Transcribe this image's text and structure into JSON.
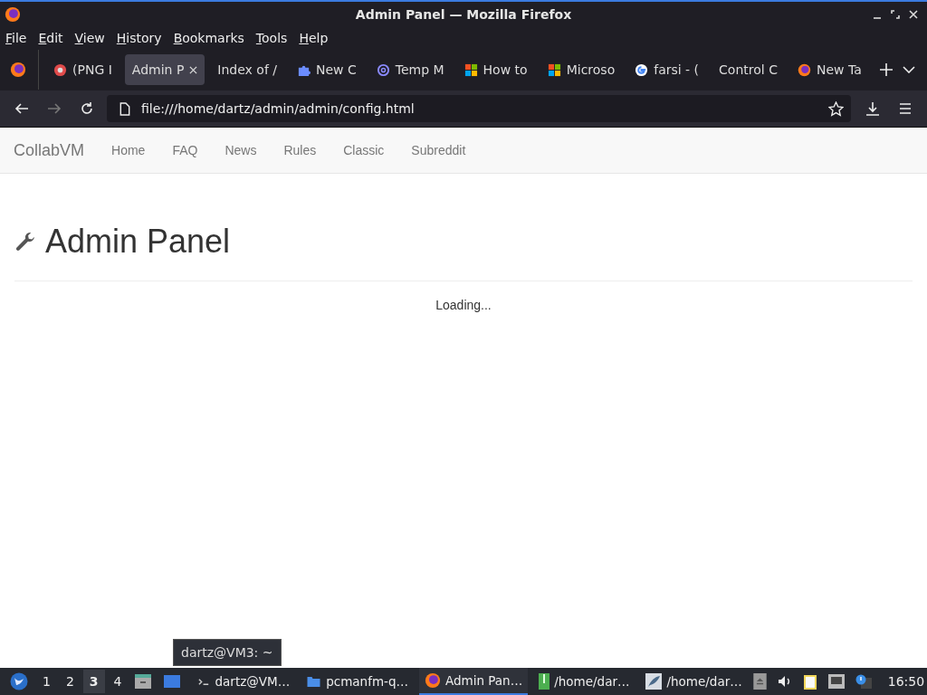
{
  "window": {
    "title": "Admin Panel — Mozilla Firefox"
  },
  "menu": [
    {
      "label": "File"
    },
    {
      "label": "Edit"
    },
    {
      "label": "View"
    },
    {
      "label": "History"
    },
    {
      "label": "Bookmarks"
    },
    {
      "label": "Tools"
    },
    {
      "label": "Help"
    }
  ],
  "tabs": [
    {
      "label": "(PNG I",
      "kind": "red",
      "selected": false
    },
    {
      "label": "Admin P",
      "kind": "none",
      "selected": true
    },
    {
      "label": "Index of /",
      "kind": "none",
      "selected": false
    },
    {
      "label": "New C",
      "kind": "puzzle",
      "selected": false
    },
    {
      "label": "Temp M",
      "kind": "at",
      "selected": false
    },
    {
      "label": "How to",
      "kind": "windows",
      "selected": false
    },
    {
      "label": "Microso",
      "kind": "windows",
      "selected": false
    },
    {
      "label": "farsi - (",
      "kind": "google",
      "selected": false
    },
    {
      "label": "Control C",
      "kind": "none",
      "selected": false
    },
    {
      "label": "New Ta",
      "kind": "firefox",
      "selected": false
    }
  ],
  "address": "file:///home/dartz/admin/admin/config.html",
  "site": {
    "brand": "CollabVM",
    "nav": [
      "Home",
      "FAQ",
      "News",
      "Rules",
      "Classic",
      "Subreddit"
    ],
    "heading": "Admin Panel",
    "status": "Loading..."
  },
  "taskbar": {
    "desktops": [
      {
        "label": "1",
        "selected": false
      },
      {
        "label": "2",
        "selected": false
      },
      {
        "label": "3",
        "selected": true
      },
      {
        "label": "4",
        "selected": false
      }
    ],
    "tasks": [
      {
        "label": "dartz@VM…",
        "kind": "terminal",
        "selected": false
      },
      {
        "label": "pcmanfm-q…",
        "kind": "folder",
        "selected": false
      },
      {
        "label": "Admin Pan…",
        "kind": "firefox",
        "selected": true
      },
      {
        "label": "/home/dar…",
        "kind": "archive",
        "selected": false
      },
      {
        "label": "/home/dar…",
        "kind": "feather",
        "selected": false
      }
    ],
    "clock": "16:50",
    "tooltip": "dartz@VM3: ~"
  }
}
